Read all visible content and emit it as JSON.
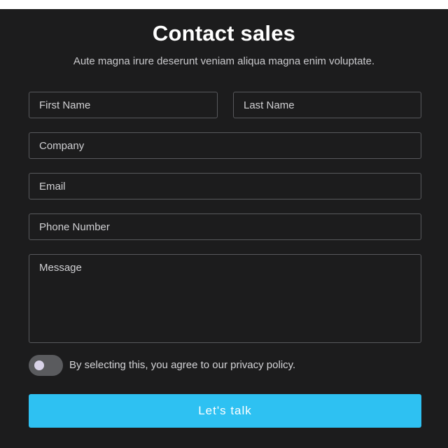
{
  "header": {
    "title": "Contact sales",
    "subtitle": "Aute magna irure deserunt veniam aliqua magna enim voluptate."
  },
  "form": {
    "first_name_placeholder": "First Name",
    "last_name_placeholder": "Last Name",
    "company_placeholder": "Company",
    "email_placeholder": "Email",
    "phone_placeholder": "Phone Number",
    "message_placeholder": "Message"
  },
  "consent": {
    "label": "By selecting this, you agree to our privacy policy.",
    "checked": false
  },
  "submit": {
    "label": "Let's talk"
  },
  "colors": {
    "background": "#1c1c1d",
    "field_border": "#58595c",
    "accent": "#2ec1f2",
    "toggle_track": "#5a5b5e",
    "toggle_knob": "#d9d3e8"
  }
}
